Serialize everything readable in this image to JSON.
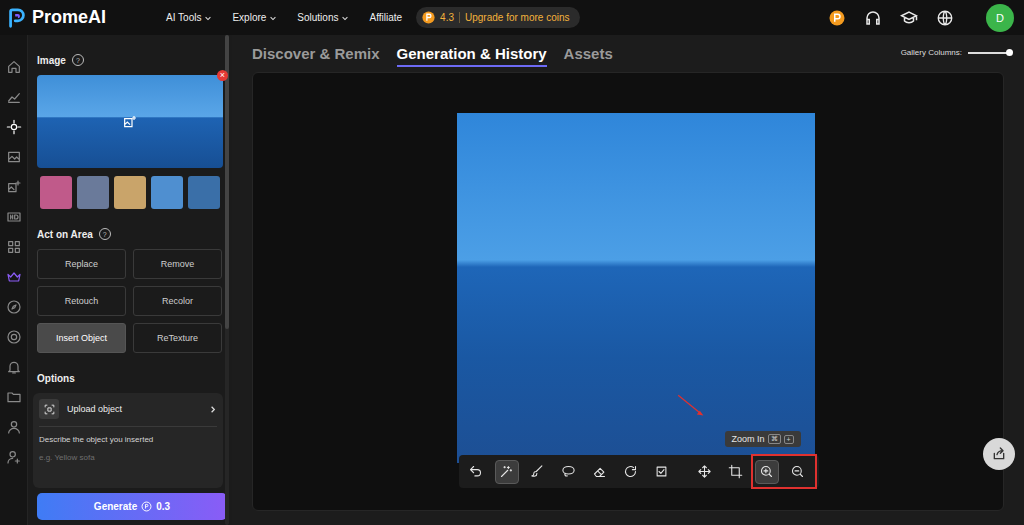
{
  "topbar": {
    "logo": "PromeAI",
    "nav": [
      {
        "label": "AI Tools",
        "dropdown": true
      },
      {
        "label": "Explore",
        "dropdown": true
      },
      {
        "label": "Solutions",
        "dropdown": true
      },
      {
        "label": "Affiliate",
        "dropdown": false
      }
    ],
    "coins": "4.3",
    "upgrade": "Upgrade for more coins",
    "avatar": "D"
  },
  "rail": {
    "items": [
      {
        "color": "#8a8a8a"
      },
      {
        "color": "#8a8a8a"
      },
      {
        "color": "#ffffff"
      },
      {
        "color": "#8a8a8a"
      },
      {
        "color": "#8a8a8a"
      },
      {
        "color": "#8a8a8a"
      },
      {
        "color": "#8a8a8a"
      },
      {
        "color": "#8b5cf6"
      },
      {
        "color": "#8a8a8a"
      },
      {
        "color": "#8a8a8a"
      },
      {
        "color": "#8a8a8a"
      },
      {
        "color": "#8a8a8a"
      },
      {
        "color": "#8a8a8a"
      },
      {
        "color": "#8a8a8a"
      }
    ]
  },
  "panel": {
    "image": {
      "label": "Image",
      "help": "?",
      "remove": "×"
    },
    "thumbnails": [
      {
        "color": "#c05a8a"
      },
      {
        "color": "#6a7a9a"
      },
      {
        "color": "#c9a46a"
      },
      {
        "color": "#4f8fd0"
      },
      {
        "color": "#3a6fa8"
      }
    ],
    "act_on_area": {
      "label": "Act on Area",
      "help": "?",
      "actions": [
        {
          "label": "Replace",
          "selected": false
        },
        {
          "label": "Remove",
          "selected": false
        },
        {
          "label": "Retouch",
          "selected": false
        },
        {
          "label": "Recolor",
          "selected": false
        },
        {
          "label": "Insert Object",
          "selected": true
        },
        {
          "label": "ReTexture",
          "selected": false
        }
      ]
    },
    "options": {
      "label": "Options",
      "upload": "Upload object",
      "describe": "Describe the object you inserted",
      "placeholder": "e.g. Yellow sofa"
    },
    "generate": {
      "label": "Generate",
      "cost": "0.3"
    }
  },
  "main": {
    "tabs": [
      {
        "label": "Discover & Remix",
        "selected": false
      },
      {
        "label": "Generation & History",
        "selected": true
      },
      {
        "label": "Assets",
        "selected": false
      }
    ],
    "gallery": {
      "label": "Gallery Columns:",
      "level": 0.95
    },
    "toolbar": {
      "tools": [
        {
          "selected": false
        },
        {
          "selected": true
        },
        {
          "selected": false
        },
        {
          "selected": false
        },
        {
          "selected": false
        },
        {
          "selected": false
        },
        {
          "selected": false
        },
        {
          "selected": false
        },
        {
          "selected": false
        },
        {
          "selected": true
        },
        {
          "selected": false
        }
      ]
    },
    "tooltip": {
      "label": "Zoom In",
      "keys": [
        "⌘",
        "+"
      ]
    }
  }
}
